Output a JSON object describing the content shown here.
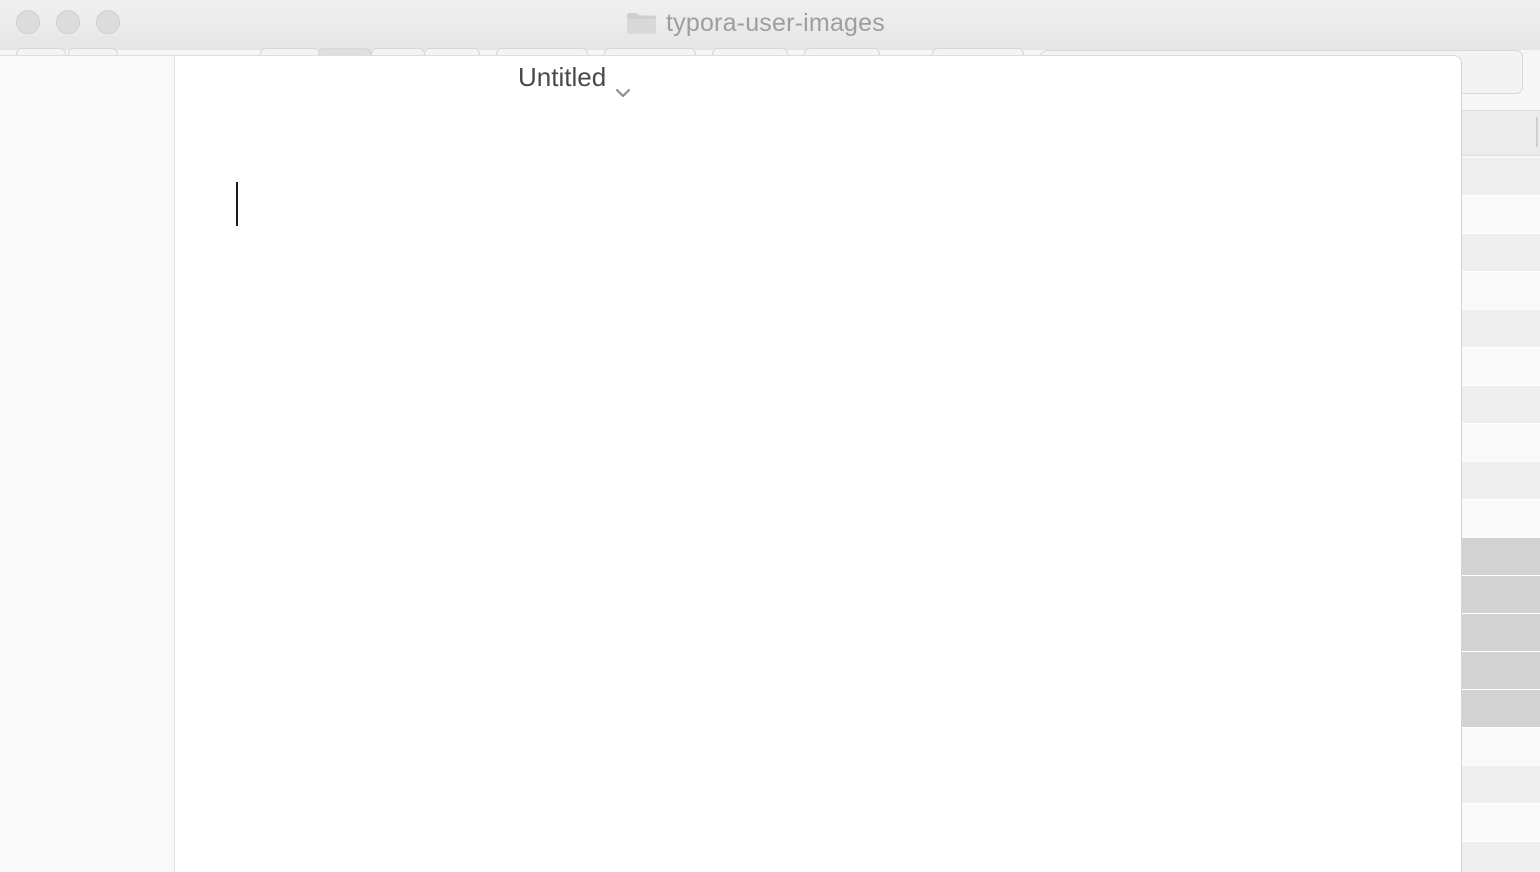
{
  "finder": {
    "title": "typora-user-images",
    "icon": "folder-icon"
  },
  "typora": {
    "document_title": "Untitled",
    "title_menu_icon": "chevron-down-icon"
  },
  "colors": {
    "finder_title_text": "#9e9e9e",
    "doc_title_text": "#4a4a4a",
    "sidebar_bg": "#f9f9f9",
    "editor_bg": "#ffffff",
    "selected_row": "#d2d2d2"
  }
}
